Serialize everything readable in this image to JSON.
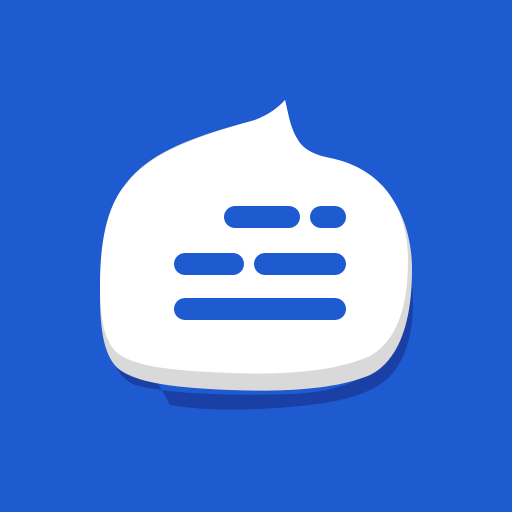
{
  "icon": {
    "name": "chat-bubble-text-lines-icon",
    "colors": {
      "background": "#1f5bd0",
      "shadow": "#1a3fa5",
      "bubble": "#ffffff",
      "bubble_edge": "#d9d9d9",
      "text_lines": "#1f5bd0"
    }
  }
}
